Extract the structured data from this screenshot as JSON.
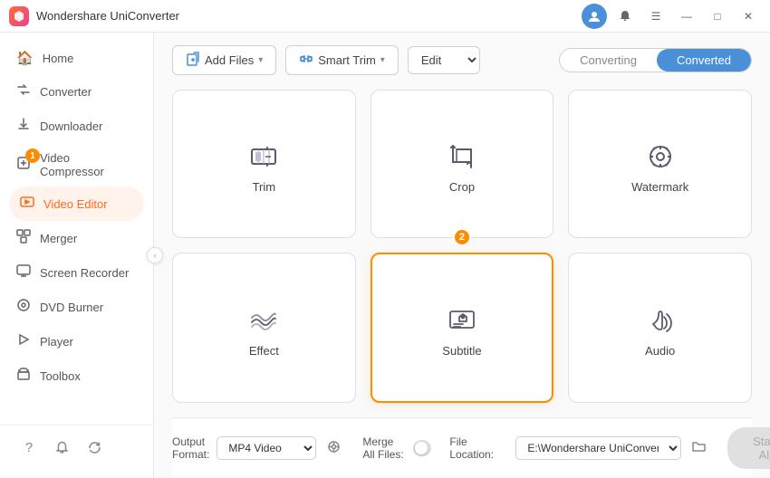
{
  "app": {
    "title": "Wondershare UniConverter",
    "logo_text": "W"
  },
  "titlebar": {
    "controls": {
      "minimize": "—",
      "maximize": "□",
      "close": "✕"
    }
  },
  "sidebar": {
    "items": [
      {
        "id": "home",
        "label": "Home",
        "icon": "🏠",
        "badge": null,
        "active": false
      },
      {
        "id": "converter",
        "label": "Converter",
        "icon": "⇄",
        "badge": null,
        "active": false
      },
      {
        "id": "downloader",
        "label": "Downloader",
        "icon": "⬇",
        "badge": null,
        "active": false
      },
      {
        "id": "compressor",
        "label": "Video Compressor",
        "icon": "▣",
        "badge": "1",
        "active": false
      },
      {
        "id": "video-editor",
        "label": "Video Editor",
        "icon": "✦",
        "badge": null,
        "active": true
      },
      {
        "id": "merger",
        "label": "Merger",
        "icon": "⊞",
        "badge": null,
        "active": false
      },
      {
        "id": "screen-recorder",
        "label": "Screen Recorder",
        "icon": "▶",
        "badge": null,
        "active": false
      },
      {
        "id": "dvd-burner",
        "label": "DVD Burner",
        "icon": "⊙",
        "badge": null,
        "active": false
      },
      {
        "id": "player",
        "label": "Player",
        "icon": "▷",
        "badge": null,
        "active": false
      },
      {
        "id": "toolbox",
        "label": "Toolbox",
        "icon": "⊕",
        "badge": null,
        "active": false
      }
    ],
    "bottom_buttons": [
      "?",
      "🔔",
      "↺"
    ]
  },
  "toolbar": {
    "add_button_label": "Add Files",
    "smart_button_label": "Smart Trim",
    "edit_label": "Edit",
    "converting_tab": "Converting",
    "converted_tab": "Converted"
  },
  "editor": {
    "cards": [
      {
        "id": "trim",
        "label": "Trim",
        "badge": null,
        "selected": false
      },
      {
        "id": "crop",
        "label": "Crop",
        "badge": "2",
        "selected": false
      },
      {
        "id": "watermark",
        "label": "Watermark",
        "badge": null,
        "selected": false
      },
      {
        "id": "effect",
        "label": "Effect",
        "badge": null,
        "selected": false
      },
      {
        "id": "subtitle",
        "label": "Subtitle",
        "badge": null,
        "selected": true
      },
      {
        "id": "audio",
        "label": "Audio",
        "badge": null,
        "selected": false
      }
    ]
  },
  "bottom_bar": {
    "output_format_label": "Output Format:",
    "output_format_value": "MP4 Video",
    "file_location_label": "File Location:",
    "file_location_value": "E:\\Wondershare UniConverter",
    "merge_all_label": "Merge All Files:",
    "start_all_label": "Start All"
  }
}
